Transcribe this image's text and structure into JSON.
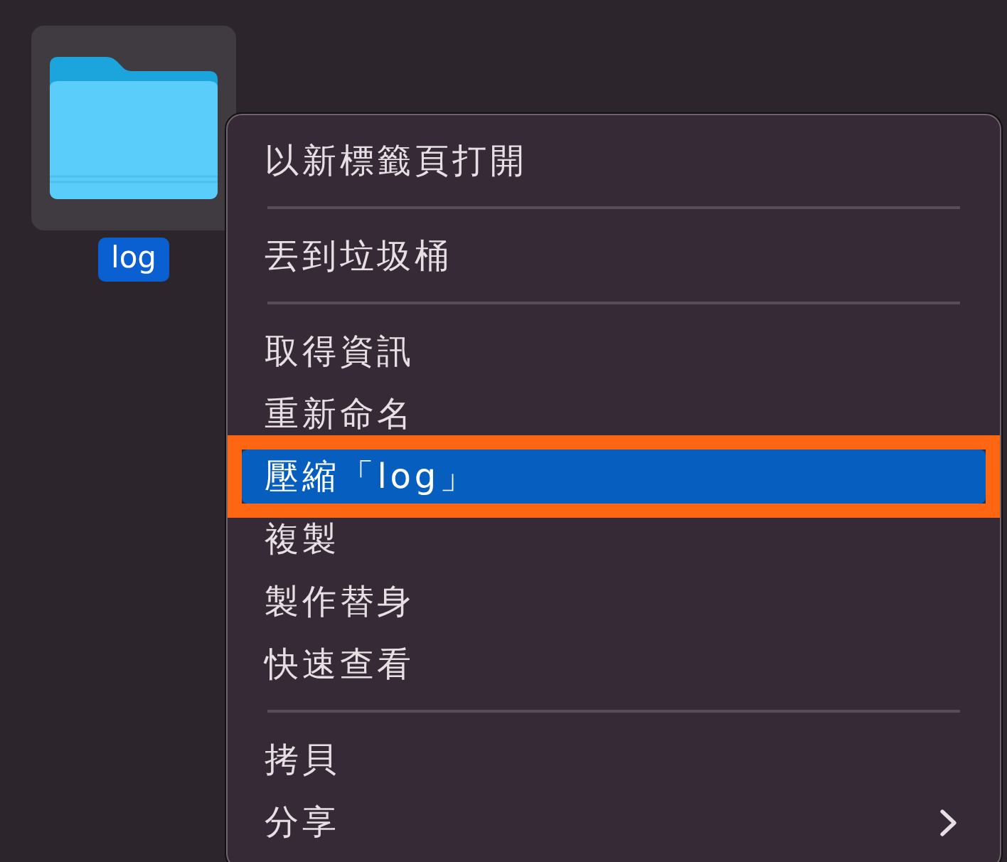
{
  "desktop_item": {
    "name": "log",
    "selected": true
  },
  "menu": {
    "items": [
      {
        "kind": "item",
        "label": "以新標籤頁打開",
        "selected": false,
        "outlined": false,
        "submenu": false
      },
      {
        "kind": "separator"
      },
      {
        "kind": "item",
        "label": "丟到垃圾桶",
        "selected": false,
        "outlined": false,
        "submenu": false
      },
      {
        "kind": "separator"
      },
      {
        "kind": "item",
        "label": "取得資訊",
        "selected": false,
        "outlined": false,
        "submenu": false
      },
      {
        "kind": "item",
        "label": "重新命名",
        "selected": false,
        "outlined": false,
        "submenu": false
      },
      {
        "kind": "item",
        "label": "壓縮「log」",
        "selected": true,
        "outlined": true,
        "submenu": false
      },
      {
        "kind": "item",
        "label": "複製",
        "selected": false,
        "outlined": false,
        "submenu": false
      },
      {
        "kind": "item",
        "label": "製作替身",
        "selected": false,
        "outlined": false,
        "submenu": false
      },
      {
        "kind": "item",
        "label": "快速查看",
        "selected": false,
        "outlined": false,
        "submenu": false
      },
      {
        "kind": "separator"
      },
      {
        "kind": "item",
        "label": "拷貝",
        "selected": false,
        "outlined": false,
        "submenu": false
      },
      {
        "kind": "item",
        "label": "分享",
        "selected": false,
        "outlined": false,
        "submenu": true
      }
    ]
  }
}
